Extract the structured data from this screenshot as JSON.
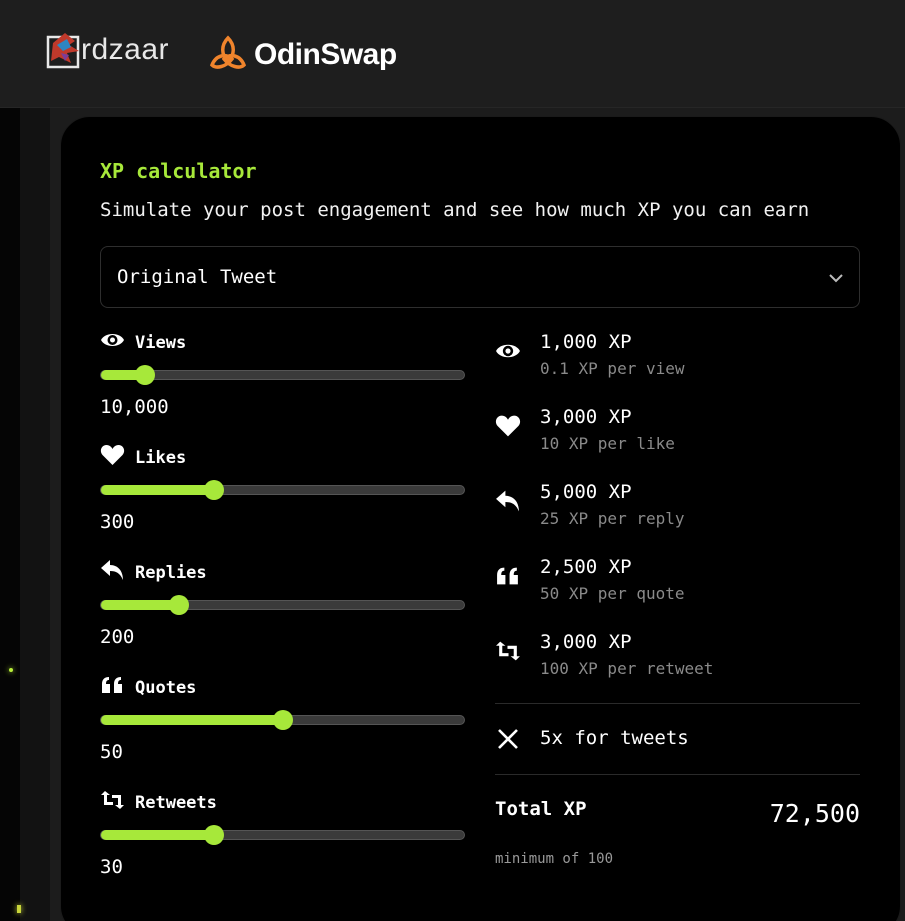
{
  "header": {
    "brand1_text": "rdzaar",
    "brand2_text": "OdinSwap"
  },
  "calculator": {
    "title": "XP calculator",
    "subtitle": "Simulate your post engagement and see how much XP you can earn",
    "post_type_select": "Original Tweet"
  },
  "sliders": [
    {
      "label": "Views",
      "value": "10,000",
      "fill_fraction": 0.12,
      "icon": "eye-icon"
    },
    {
      "label": "Likes",
      "value": "300",
      "fill_fraction": 0.31,
      "icon": "heart-icon"
    },
    {
      "label": "Replies",
      "value": "200",
      "fill_fraction": 0.215,
      "icon": "reply-icon"
    },
    {
      "label": "Quotes",
      "value": "50",
      "fill_fraction": 0.5,
      "icon": "quote-icon"
    },
    {
      "label": "Retweets",
      "value": "30",
      "fill_fraction": 0.31,
      "icon": "retweet-icon"
    }
  ],
  "breakdown": [
    {
      "xp": "1,000 XP",
      "rate": "0.1 XP per view",
      "icon": "eye-icon"
    },
    {
      "xp": "3,000 XP",
      "rate": "10 XP per like",
      "icon": "heart-icon"
    },
    {
      "xp": "5,000 XP",
      "rate": "25 XP per reply",
      "icon": "reply-icon"
    },
    {
      "xp": "2,500 XP",
      "rate": "50 XP per quote",
      "icon": "quote-icon"
    },
    {
      "xp": "3,000 XP",
      "rate": "100 XP per retweet",
      "icon": "retweet-icon"
    }
  ],
  "multiplier": {
    "text": "5x for tweets",
    "icon": "x-logo-icon"
  },
  "total": {
    "label": "Total XP",
    "value": "72,500",
    "minimum": "minimum of 100"
  },
  "colors": {
    "accent": "#a7e83a",
    "track": "#3a3a3a",
    "muted": "#8a8a8a"
  }
}
